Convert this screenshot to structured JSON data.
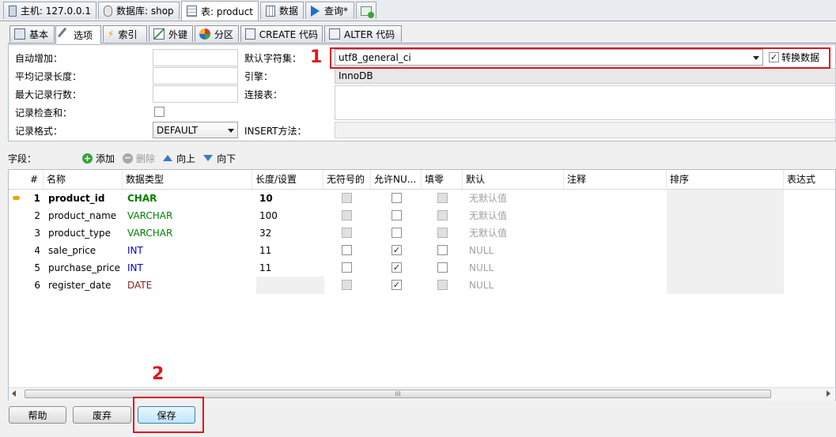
{
  "top_tabs": {
    "host": "主机: 127.0.0.1",
    "database": "数据库: shop",
    "table": "表: product",
    "data": "数据",
    "query": "查询*"
  },
  "sub_tabs": [
    "基本",
    "选项",
    "索引",
    "外键",
    "分区",
    "CREATE 代码",
    "ALTER 代码"
  ],
  "options": {
    "auto_increment_label": "自动增加：",
    "avg_row_length_label": "平均记录长度：",
    "max_rows_label": "最大记录行数：",
    "checksum_label": "记录检查和：",
    "row_format_label": "记录格式：",
    "row_format_value": "DEFAULT",
    "default_collation_label": "默认字符集：",
    "default_collation_value": "utf8_general_ci",
    "convert_data_label": "转换数据",
    "convert_data_checked": true,
    "engine_label": "引擎：",
    "engine_value": "InnoDB",
    "union_label": "连接表：",
    "insert_method_label": "INSERT方法："
  },
  "fields_toolbar": {
    "label": "字段：",
    "add": "添加",
    "remove": "删除",
    "up": "向上",
    "down": "向下"
  },
  "columns_header": [
    "#",
    "名称",
    "数据类型",
    "长度/设置",
    "无符号的",
    "允许NU...",
    "填零",
    "默认",
    "注释",
    "排序",
    "表达式"
  ],
  "rows": [
    {
      "num": "1",
      "name": "product_id",
      "type": "CHAR",
      "length": "10",
      "unsigned": false,
      "unsigned_enabled": false,
      "nullable": false,
      "zerofill_enabled": false,
      "default": "无默认值",
      "key": true,
      "type_color": "#008000",
      "bold": true
    },
    {
      "num": "2",
      "name": "product_name",
      "type": "VARCHAR",
      "length": "100",
      "unsigned": false,
      "unsigned_enabled": false,
      "nullable": false,
      "zerofill_enabled": false,
      "default": "无默认值",
      "key": false,
      "type_color": "#008000",
      "bold": false
    },
    {
      "num": "3",
      "name": "product_type",
      "type": "VARCHAR",
      "length": "32",
      "unsigned": false,
      "unsigned_enabled": false,
      "nullable": false,
      "zerofill_enabled": false,
      "default": "无默认值",
      "key": false,
      "type_color": "#008000",
      "bold": false
    },
    {
      "num": "4",
      "name": "sale_price",
      "type": "INT",
      "length": "11",
      "unsigned": false,
      "unsigned_enabled": true,
      "nullable": true,
      "zerofill_enabled": true,
      "default": "NULL",
      "key": false,
      "type_color": "#0000c8",
      "bold": false
    },
    {
      "num": "5",
      "name": "purchase_price",
      "type": "INT",
      "length": "11",
      "unsigned": false,
      "unsigned_enabled": true,
      "nullable": true,
      "zerofill_enabled": true,
      "default": "NULL",
      "key": false,
      "type_color": "#0000c8",
      "bold": false
    },
    {
      "num": "6",
      "name": "register_date",
      "type": "DATE",
      "length": "",
      "unsigned": false,
      "unsigned_enabled": false,
      "nullable": true,
      "zerofill_enabled": false,
      "default": "NULL",
      "key": false,
      "type_color": "#8b1a1a",
      "bold": false
    }
  ],
  "buttons": {
    "help": "帮助",
    "discard": "废弃",
    "save": "保存"
  },
  "annotations": {
    "first": "1",
    "second": "2"
  },
  "scrollbar_grip": "III",
  "colors": {
    "highlight_red": "#e0141e",
    "default_text_gray": "#a0a0a0"
  }
}
